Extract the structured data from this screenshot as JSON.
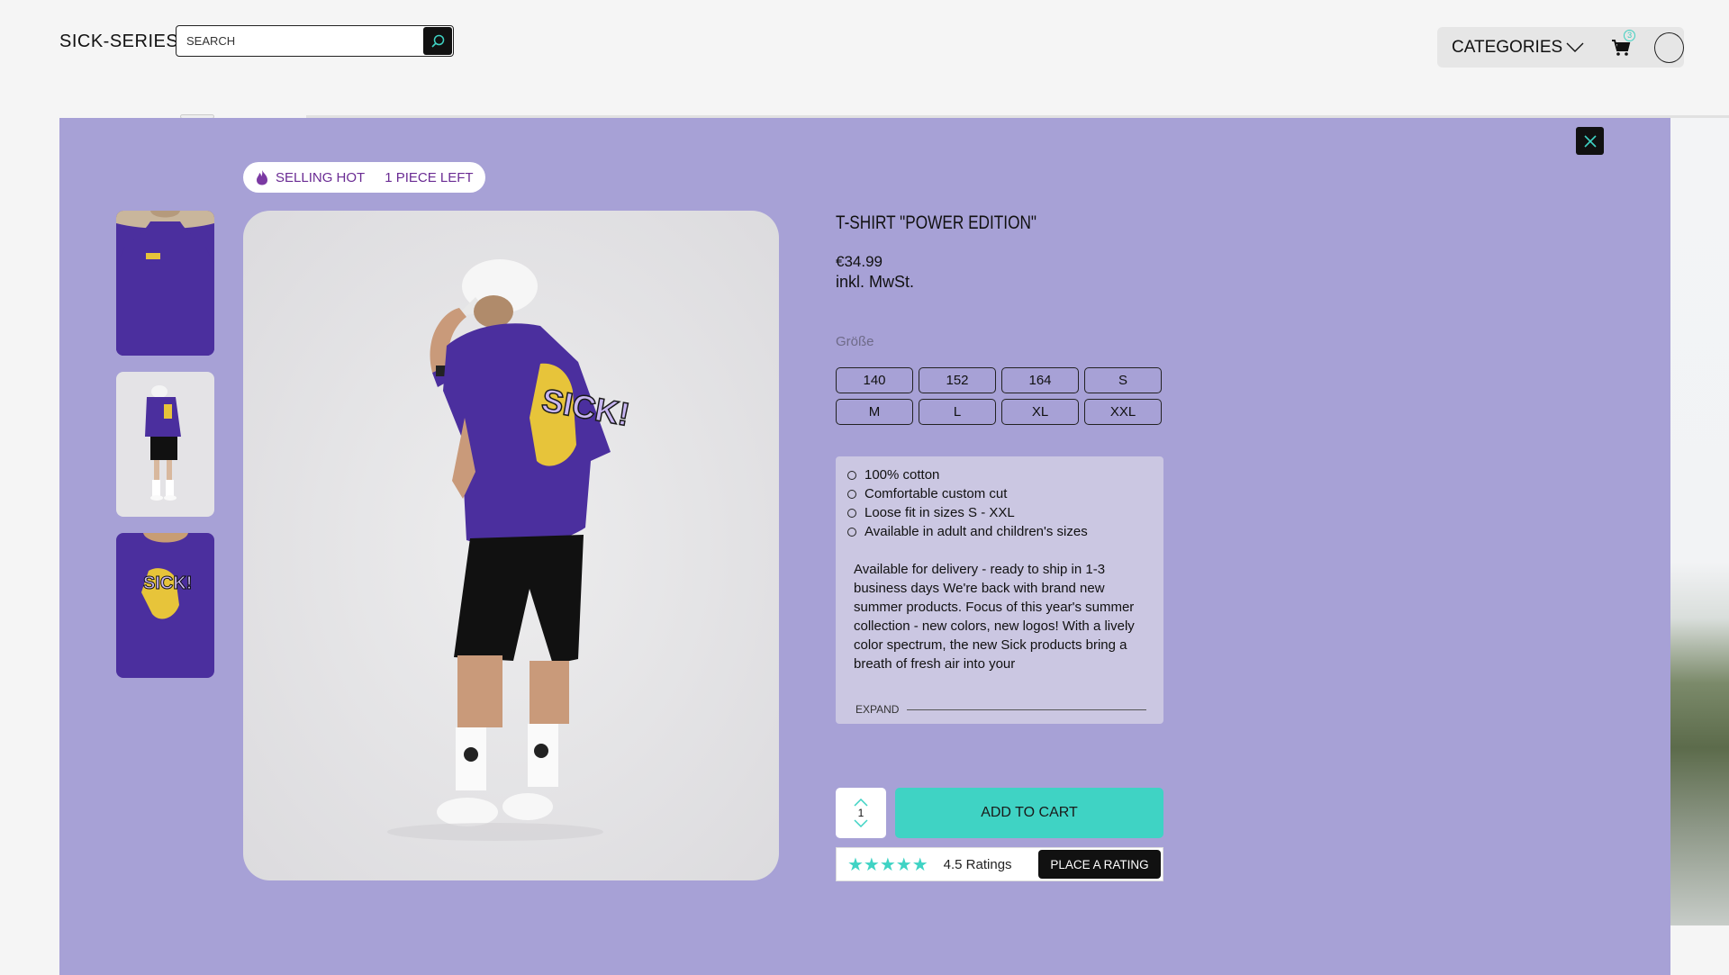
{
  "header": {
    "logo": "SICK-SERIES",
    "search_placeholder": "SEARCH",
    "categories_label": "CATEGORIES",
    "cart_count": "3"
  },
  "badge": {
    "hot_label": "SELLING HOT",
    "stock_label": "1 PIECE LEFT"
  },
  "product": {
    "title": "T-SHIRT \"POWER EDITION\"",
    "price": "€34.99",
    "tax_note": "inkl. MwSt.",
    "size_label": "Größe",
    "sizes": [
      "140",
      "152",
      "164",
      "S",
      "M",
      "L",
      "XL",
      "XXL"
    ],
    "features": [
      "100% cotton",
      "Comfortable custom cut",
      "Loose fit in sizes S - XXL",
      "Available in adult and children's sizes"
    ],
    "description": "Available for delivery - ready to ship in 1-3 business days We're back with brand new summer products. Focus of this year's summer collection - new colors, new logos! With a lively color spectrum, the new Sick products bring a breath of fresh air into your",
    "expand_label": "EXPAND",
    "quantity": "1",
    "add_to_cart_label": "ADD TO CART",
    "stars": "★★★★★",
    "rating_text": "4.5 Ratings",
    "place_rating_label": "PLACE A RATING"
  },
  "colors": {
    "modal_bg": "#a7a1d6",
    "accent": "#3fd3c4",
    "shirt": "#4b2f9e",
    "print": "#e7c43a"
  }
}
